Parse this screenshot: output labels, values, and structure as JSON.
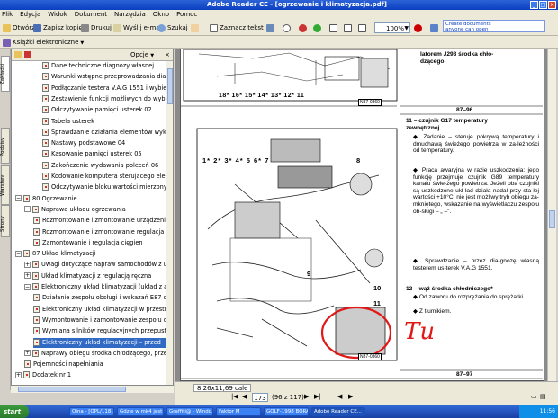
{
  "window": {
    "title": "Adobe Reader CE - [ogrzewanie i klimatyzacja.pdf]"
  },
  "menu": [
    "Plik",
    "Edycja",
    "Widok",
    "Dokument",
    "Narzędzia",
    "Okno",
    "Pomoc"
  ],
  "banner": {
    "line1": "Create documents",
    "line2": "anyone can open"
  },
  "toolbar": {
    "open": "Otwórz",
    "save_copy": "Zapisz kopię",
    "print": "Drukuj",
    "email": "Wyślij e-mail",
    "search": "Szukaj",
    "select_text": "Zaznacz tekst",
    "zoom": "100%",
    "ebooks": "Książki elektroniczne"
  },
  "panel": {
    "options": "Opcje"
  },
  "sidetabs": [
    "Zakładki",
    "Podpisy",
    "Warstwy",
    "Strony"
  ],
  "bookmarks": [
    {
      "label": "Dane techniczne diagnozy własnej",
      "level": 3
    },
    {
      "label": "Warunki wstępne przeprowadzania diagnozy",
      "level": 3
    },
    {
      "label": "Podłączanie testera V.A.G 1551 i wybierani",
      "level": 3
    },
    {
      "label": "Zestawienie funkcji możliwych do wybran",
      "level": 3
    },
    {
      "label": "Odczytywanie pamięci usterek 02",
      "level": 3
    },
    {
      "label": "Tabela usterek",
      "level": 3
    },
    {
      "label": "Sprawdzanie działania elementów wykon",
      "level": 3
    },
    {
      "label": "Nastawy podstawowe 04",
      "level": 3
    },
    {
      "label": "Kasowanie pamięci usterek 05",
      "level": 3
    },
    {
      "label": "Zakończenie wydawania poleceń 06",
      "level": 3
    },
    {
      "label": "Kodowanie komputera sterującego elektroni",
      "level": 3
    },
    {
      "label": "Odczytywanie bloku wartości mierzonych",
      "level": 3
    },
    {
      "label": "80 Ogrzewanie",
      "level": 0,
      "toggle": "−"
    },
    {
      "label": "Naprawa układu ogrzewania",
      "level": 1,
      "toggle": "−"
    },
    {
      "label": "Rozmontowanie i zmontowanie urządzenia og",
      "level": 2
    },
    {
      "label": "Rozmontowanie i zmontowanie regulacja gora",
      "level": 2
    },
    {
      "label": "Zamontowanie i regulacja cięgien",
      "level": 2
    },
    {
      "label": "87 Układ klimatyzacji",
      "level": 0,
      "toggle": "−"
    },
    {
      "label": "Uwagi dotyczące napraw samochodów z ukł",
      "level": 1,
      "toggle": "+"
    },
    {
      "label": "Układ klimatyzacji z regulacją ręczna",
      "level": 1,
      "toggle": "+"
    },
    {
      "label": "Elektroniczny układ klimatyzacji (układ z au",
      "level": 1,
      "toggle": "−"
    },
    {
      "label": "Działanie zespołu obsługi i wskazań E87 c",
      "level": 2
    },
    {
      "label": "Elektroniczny układ klimatyzacji w przestrz",
      "level": 2
    },
    {
      "label": "Wymontowanie i zamontowanie zespołu ob",
      "level": 2
    },
    {
      "label": "Wymiana silników regulacyjnych przepust",
      "level": 2
    },
    {
      "label": "Elektroniczny układ klimatyzacji – przed",
      "level": 2,
      "selected": true
    },
    {
      "label": "Naprawy obiegu środka chłodzącego, przepro",
      "level": 1,
      "toggle": "+"
    },
    {
      "label": "Pojemności napełniania",
      "level": 1
    },
    {
      "label": "Dodatek nr 1",
      "level": 0,
      "toggle": "+"
    }
  ],
  "doc": {
    "top_label": "latorem J293 środka chło-\ndzącego",
    "page_top": "87–96",
    "item11_title": "11 – czujnik G17 temperatury\nzewnętrznej",
    "item11_bullets": [
      "Zadanie – steruje pokrywą temperatury i dmuchawą świeżego powietrza w za-leżności od temperatury.",
      "Praca awaryjna w razie uszkodzenia: jego funkcję przejmuje czujnik G89 temperatury kanału świe-żego powietrza. Jeżeli oba czujniki są uszkodzone ukł ład działa nadal przy sta-łej wartości +10°C; nie jest możliwy tryb obiegu za-mkniętego, wskazanie na wyświetlaczu zespołu ob-sługi – „ –”.",
      "Sprawdzanie – przez dia-gnozę własną testerem us-terek V.A.G 1551."
    ],
    "item12_title": "12 – wąż środka chłodniczego*",
    "item12_bullets": [
      "Od zaworu do rozprężania do sprężarki.",
      "Z tłumikiem."
    ],
    "page_bottom": "87–97",
    "figure_top_code": "N87-0360",
    "figure_main_code": "N87-0360",
    "figure_labels_top": [
      "18*",
      "16*",
      "15*",
      "14*",
      "13*",
      "12*",
      "11"
    ],
    "figure_labels_main": [
      "1*",
      "2*",
      "3*",
      "4*",
      "5",
      "6*",
      "7",
      "8",
      "9",
      "10",
      "11"
    ],
    "handwriting": "Tu"
  },
  "status": {
    "page_size": "8,26x11,69 cale",
    "page_current": "173",
    "page_of": "(96 z 117)"
  },
  "taskbar": {
    "start": "start",
    "items": [
      "Oina - [OPL/118...",
      "Gdzie w mk4 jest ...",
      "Graffiti@ - Windo...",
      "Faktor M",
      "GOLF-1998 BORA...",
      "Adobe Reader CE..."
    ],
    "clock": "11:56"
  }
}
